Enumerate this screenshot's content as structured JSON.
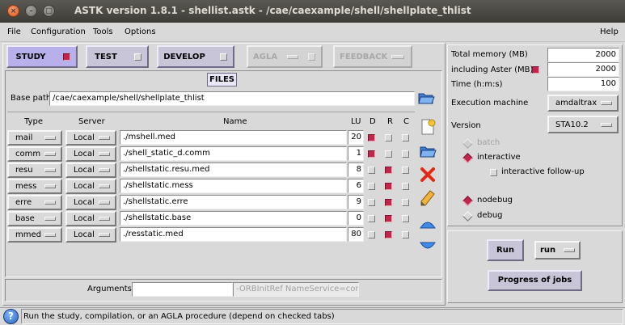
{
  "window": {
    "title": "ASTK version 1.8.1 - shellist.astk - /cae/caexample/shell/shellplate_thlist",
    "close_glyph": "×",
    "min_glyph": "–",
    "max_glyph": "□"
  },
  "menubar": {
    "file": "File",
    "configuration": "Configuration",
    "tools": "Tools",
    "options": "Options",
    "help": "Help"
  },
  "tabs": {
    "study": "STUDY",
    "test": "TEST",
    "develop": "DEVELOP",
    "agla": "AGLA",
    "feedback": "FEEDBACK"
  },
  "files": {
    "title": "FILES",
    "base_path_label": "Base path",
    "base_path_value": "/cae/caexample/shell/shellplate_thlist",
    "headers": {
      "type": "Type",
      "server": "Server",
      "name": "Name",
      "lu": "LU",
      "d": "D",
      "r": "R",
      "c": "C"
    },
    "rows": [
      {
        "type": "mail",
        "server": "Local",
        "name": "./mshell.med",
        "lu": "20",
        "d": true,
        "r": false,
        "c": false
      },
      {
        "type": "comm",
        "server": "Local",
        "name": "./shell_static_d.comm",
        "lu": "1",
        "d": true,
        "r": false,
        "c": false
      },
      {
        "type": "resu",
        "server": "Local",
        "name": "./shellstatic.resu.med",
        "lu": "8",
        "d": false,
        "r": true,
        "c": false
      },
      {
        "type": "mess",
        "server": "Local",
        "name": "./shellstatic.mess",
        "lu": "6",
        "d": false,
        "r": true,
        "c": false
      },
      {
        "type": "erre",
        "server": "Local",
        "name": "./shellstatic.erre",
        "lu": "9",
        "d": false,
        "r": true,
        "c": false
      },
      {
        "type": "base",
        "server": "Local",
        "name": "./shellstatic.base",
        "lu": "0",
        "d": false,
        "r": true,
        "c": false
      },
      {
        "type": "mmed",
        "server": "Local",
        "name": "./resstatic.med",
        "lu": "80",
        "d": false,
        "r": true,
        "c": false
      }
    ],
    "arguments_label": "Arguments",
    "arguments_value": "",
    "arguments_extra": "-ORBInitRef NameService=corba"
  },
  "settings": {
    "total_memory_label": "Total memory (MB)",
    "total_memory_value": "2000",
    "including_aster_label": "including Aster (MB)",
    "including_aster_value": "2000",
    "time_label": "Time (h:m:s)",
    "time_value": "100",
    "exec_machine_label": "Execution machine",
    "exec_machine_value": "amdaltrax",
    "version_label": "Version",
    "version_value": "STA10.2",
    "batch": "batch",
    "interactive": "interactive",
    "interactive_followup": "interactive follow-up",
    "nodebug": "nodebug",
    "debug": "debug"
  },
  "run": {
    "run_button": "Run",
    "run_mode": "run",
    "progress_button": "Progress of jobs"
  },
  "status": {
    "help_glyph": "?",
    "text": "Run the study, compilation, or an AGLA procedure (depend on checked tabs)"
  }
}
